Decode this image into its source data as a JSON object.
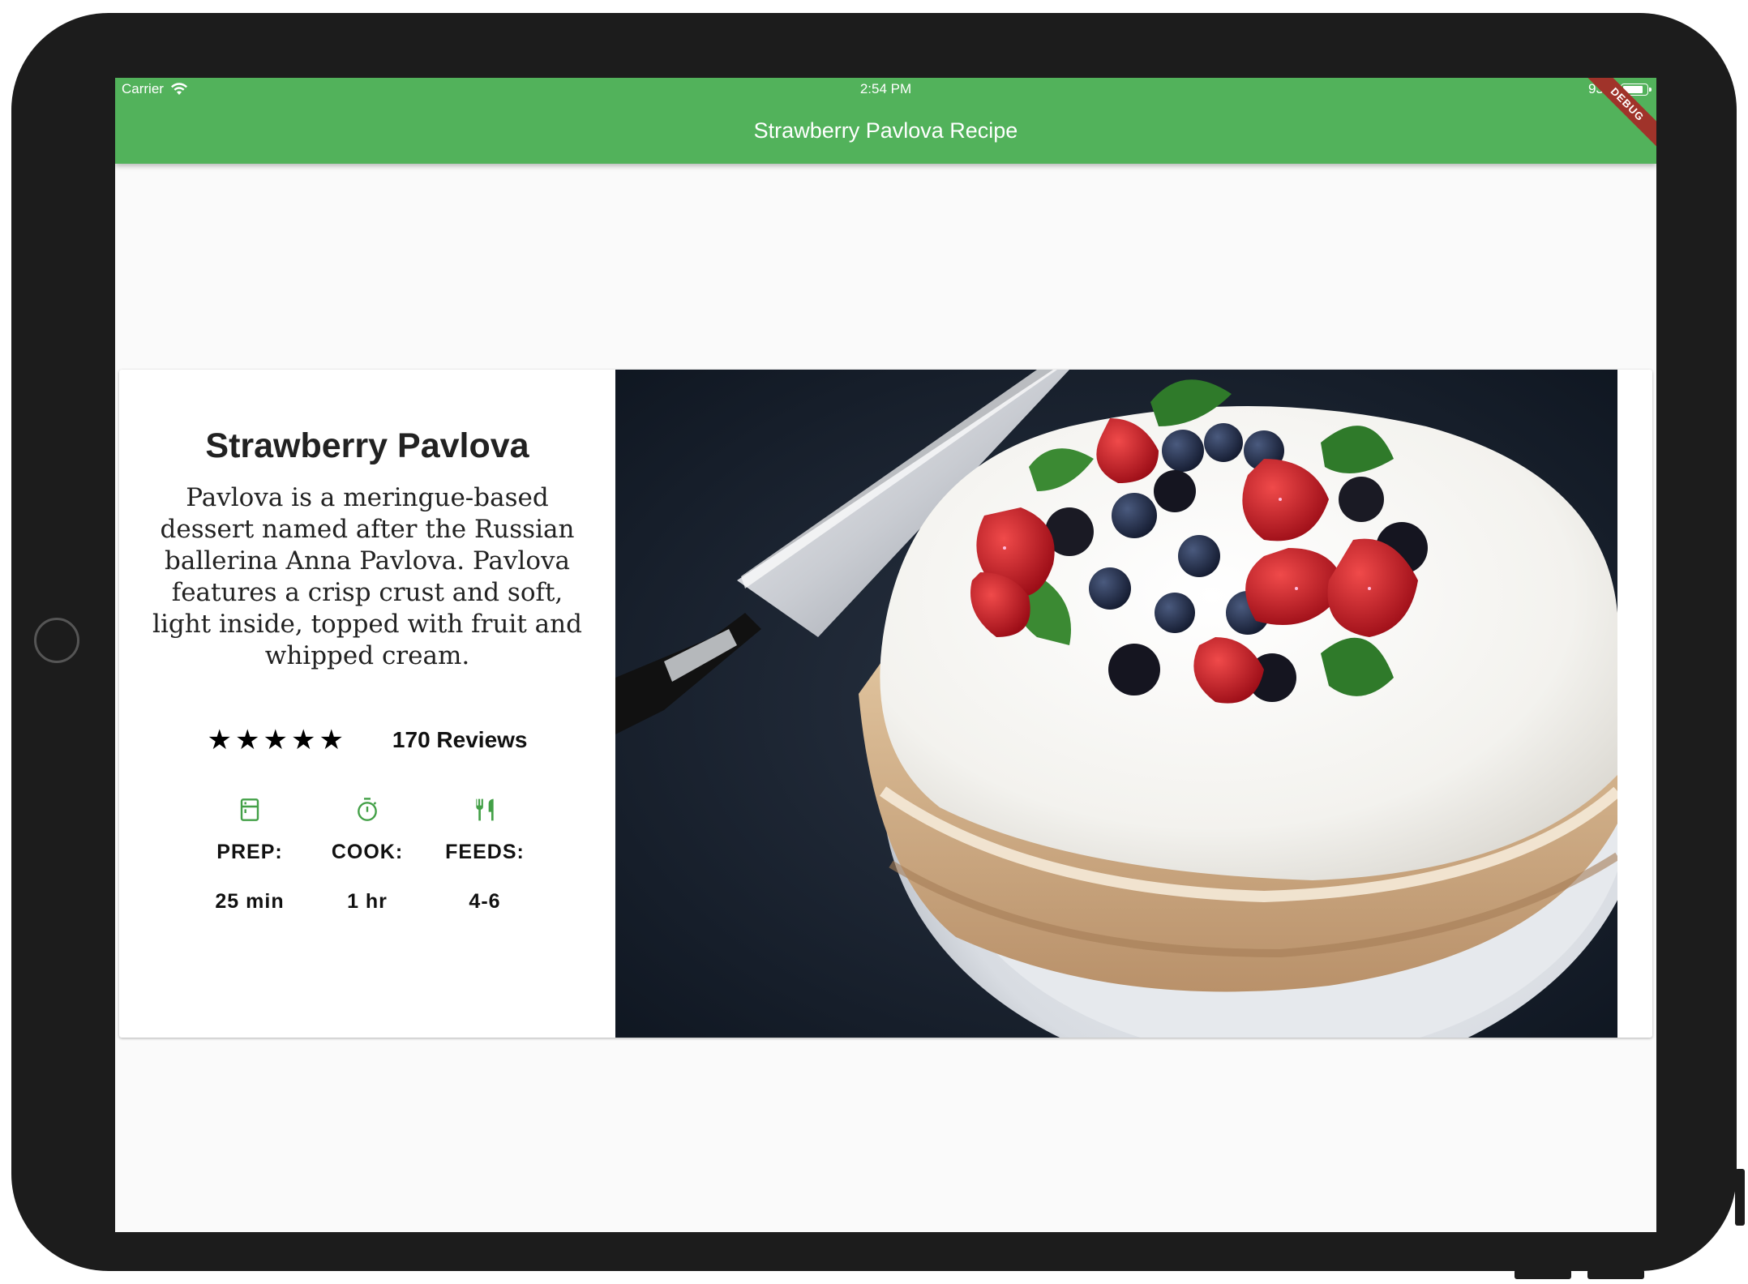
{
  "status_bar": {
    "carrier": "Carrier",
    "time": "2:54 PM",
    "battery": "93%",
    "battery_level": 0.93
  },
  "app_bar": {
    "title": "Strawberry Pavlova Recipe",
    "debug_banner": "DEBUG",
    "color": "#52b25b"
  },
  "recipe": {
    "title": "Strawberry Pavlova",
    "description": "Pavlova is a meringue-based dessert named after the Russian ballerina Anna Pavlova. Pavlova features a crisp crust and soft, light inside, topped with fruit and whipped cream.",
    "rating": 5,
    "rating_max": 5,
    "reviews": "170 Reviews",
    "stats": [
      {
        "icon": "kitchen-icon",
        "label": "PREP:",
        "value": "25 min"
      },
      {
        "icon": "timer-icon",
        "label": "COOK:",
        "value": "1 hr"
      },
      {
        "icon": "restaurant-icon",
        "label": "FEEDS:",
        "value": "4-6"
      }
    ],
    "icon_color": "#43a047"
  }
}
